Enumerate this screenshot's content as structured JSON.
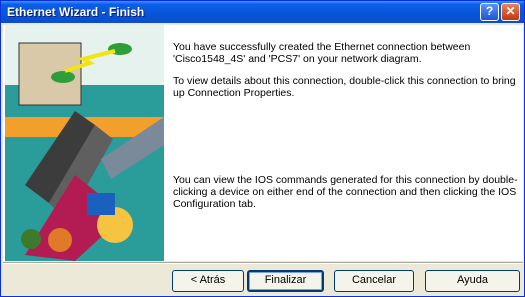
{
  "window": {
    "title": "Ethernet Wizard - Finish",
    "help_label": "?",
    "close_label": "✕"
  },
  "message": {
    "para1": "You have successfully created the Ethernet connection between 'Cisco1548_4S' and 'PCS7' on your network diagram.",
    "para2": "To view details about this connection, double-click this connection to bring up Connection Properties.",
    "para3": "You can view the IOS commands generated for this connection by double-clicking a device on either end of the connection  and then clicking the IOS Configuration tab."
  },
  "buttons": {
    "back": "< Atrás",
    "finish": "Finalizar",
    "cancel": "Cancelar",
    "help": "Ayuda"
  }
}
